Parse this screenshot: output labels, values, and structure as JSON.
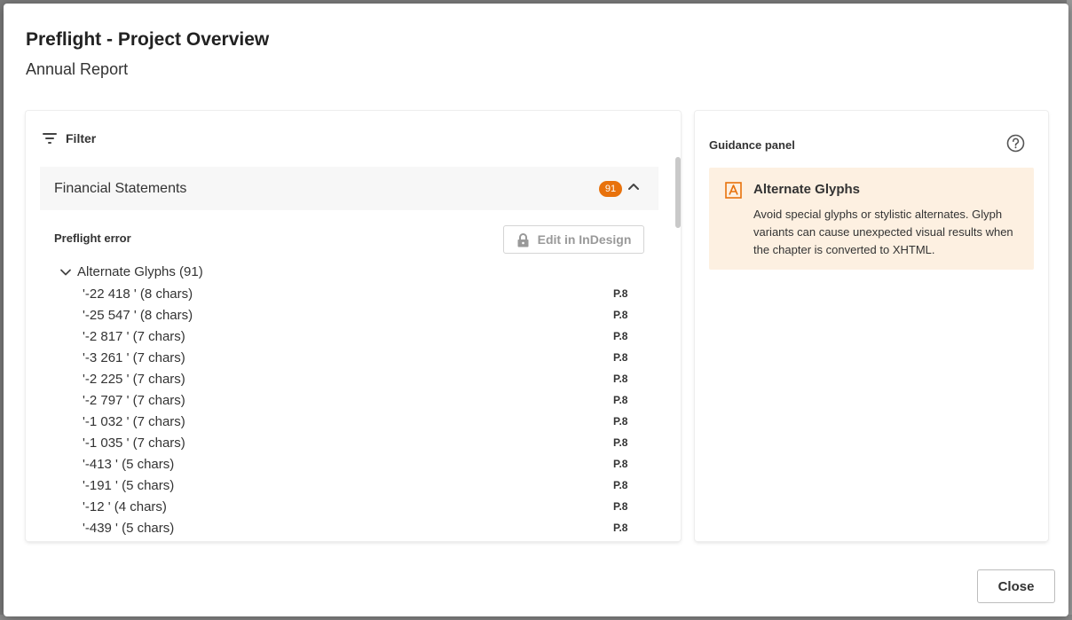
{
  "dialog": {
    "title": "Preflight - Project Overview",
    "subtitle": "Annual Report",
    "close_label": "Close"
  },
  "filter": {
    "label": "Filter",
    "icon": "filter-icon"
  },
  "group": {
    "name": "Financial Statements",
    "count": "91",
    "badge_color": "#e8720c",
    "expanded": true
  },
  "section": {
    "heading": "Preflight error",
    "edit_button_label": "Edit in InDesign",
    "edit_button_icon": "lock-icon"
  },
  "tree": {
    "parent_label": "Alternate Glyphs (91)",
    "items": [
      {
        "label": "'-22 418 ' (8 chars)",
        "page": "P.8"
      },
      {
        "label": "'-25 547 ' (8 chars)",
        "page": "P.8"
      },
      {
        "label": "'-2 817 ' (7 chars)",
        "page": "P.8"
      },
      {
        "label": "'-3 261 ' (7 chars)",
        "page": "P.8"
      },
      {
        "label": "'-2 225 ' (7 chars)",
        "page": "P.8"
      },
      {
        "label": "'-2 797 ' (7 chars)",
        "page": "P.8"
      },
      {
        "label": "'-1 032 ' (7 chars)",
        "page": "P.8"
      },
      {
        "label": "'-1 035 ' (7 chars)",
        "page": "P.8"
      },
      {
        "label": "'-413 ' (5 chars)",
        "page": "P.8"
      },
      {
        "label": "'-191 ' (5 chars)",
        "page": "P.8"
      },
      {
        "label": "'-12 ' (4 chars)",
        "page": "P.8"
      },
      {
        "label": "'-439 ' (5 chars)",
        "page": "P.8"
      }
    ]
  },
  "guidance": {
    "panel_title": "Guidance panel",
    "card_title": "Alternate Glyphs",
    "card_text": "Avoid special glyphs or stylistic alternates. Glyph variants can cause unexpected visual results when the chapter is converted to XHTML.",
    "card_bg": "#fdf0e1",
    "accent": "#e8720c"
  }
}
